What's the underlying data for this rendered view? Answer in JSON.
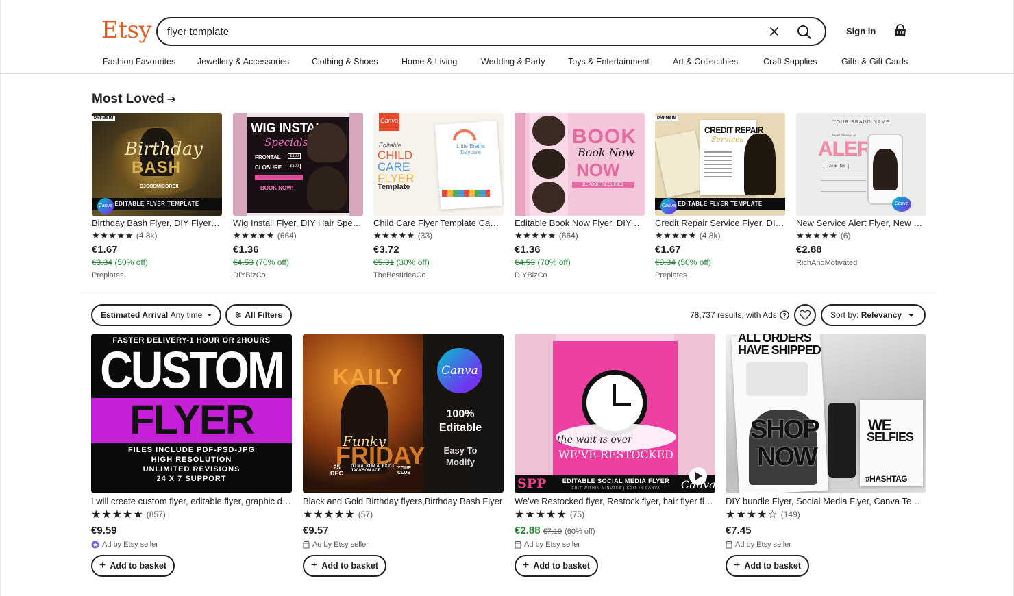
{
  "header": {
    "logo": "Etsy",
    "search_value": "flyer template",
    "signin": "Sign in"
  },
  "categories": [
    "Fashion Favourites",
    "Jewellery & Accessories",
    "Clothing & Shoes",
    "Home & Living",
    "Wedding & Party",
    "Toys & Entertainment",
    "Art & Collectibles",
    "Craft Supplies",
    "Gifts & Gift Cards"
  ],
  "most_loved": {
    "title": "Most Loved",
    "items": [
      {
        "title": "Birthday Bash Flyer, DIY Flyer Template, Birthday Party Flyer",
        "stars": "★★★★★",
        "reviews": "(4.8k)",
        "price": "€1.67",
        "original": "€3.34",
        "discount": "(50% off)",
        "shop": "Preplates",
        "art": {
          "badge": "PREMIUM",
          "line1": "Birthday",
          "line2": "BASH",
          "strip": "EDITABLE FLYER TEMPLATE",
          "canva": "Canva",
          "dj": "DJCOSMICOREX"
        }
      },
      {
        "title": "Wig Install Flyer, DIY Hair Specials Flyer",
        "stars": "★★★★★",
        "reviews": "(664)",
        "price": "€1.36",
        "original": "€4.53",
        "discount": "(70% off)",
        "shop": "DIYBizCo",
        "art": {
          "line1": "WIG INSTALL",
          "line2": "Specials",
          "row1": "FRONTAL",
          "row2": "CLOSURE",
          "p1": "$100",
          "p2": "$100",
          "cta": "BOOK NOW!"
        }
      },
      {
        "title": "Child Care Flyer Template Canva Editable",
        "stars": "★★★★★",
        "reviews": "(33)",
        "price": "€3.72",
        "original": "€5.31",
        "discount": "(30% off)",
        "shop": "TheBestIdeaCo",
        "art": {
          "canva": "Canva",
          "small": "Editable",
          "w1": "CHILD",
          "w2": "CARE",
          "w3": "FLYER",
          "w4": "Template",
          "sub": "Little Brains Daycare"
        }
      },
      {
        "title": "Editable Book Now Flyer, DIY Beauty Flyer",
        "stars": "★★★★★",
        "reviews": "(664)",
        "price": "€1.36",
        "original": "€4.53",
        "discount": "(70% off)",
        "shop": "DIYBizCo",
        "art": {
          "w1": "BOOK",
          "w2": "Book Now",
          "w3": "NOW",
          "dep": "DEPOSIT REQUIRED"
        }
      },
      {
        "title": "Credit Repair Service Flyer, DIY Business Flyer",
        "stars": "★★★★★",
        "reviews": "(4.8k)",
        "price": "€1.67",
        "original": "€3.34",
        "discount": "(50% off)",
        "shop": "Preplates",
        "art": {
          "badge": "PREMIUM",
          "w1": "CREDIT REPAIR",
          "w2": "Services",
          "strip": "EDITABLE FLYER TEMPLATE",
          "canva": "Canva"
        }
      },
      {
        "title": "New Service Alert Flyer, New Service Template",
        "stars": "★★★★★",
        "reviews": "(6)",
        "price": "€2.88",
        "original": "",
        "discount": "",
        "shop": "RichAndMotivated",
        "art": {
          "top": "YOUR BRAND NAME",
          "w1": "ALERT",
          "w0": "NEW SERVICE",
          "tag": "TAPE INS",
          "canva": "Canva"
        }
      }
    ]
  },
  "filters": {
    "arrival_label": "Estimated Arrival",
    "arrival_value": "Any time",
    "all_filters": "All Filters",
    "results": "78,737 results, with Ads",
    "sort_label": "Sort by:",
    "sort_value": "Relevancy"
  },
  "listings": [
    {
      "title": "I will create custom flyer, editable flyer, graphic design",
      "stars": "★★★★★",
      "reviews": "(857)",
      "price": "€9.59",
      "was": "",
      "ad": "Ad by Etsy seller",
      "button": "Add to basket",
      "art": {
        "top": "FASTER DELIVERY-1 HOUR OR 2HOURS",
        "w1": "CUSTOM",
        "w2": "FLYER",
        "b1": "FILES INCLUDE PDF-PSD-JPG",
        "b2": "HIGH RESOLUTION",
        "b3": "UNLIMITED REVISIONS",
        "b4": "24 X 7 SUPPORT"
      }
    },
    {
      "title": "Black and Gold Birthday flyers,Birthday Bash Flyer",
      "stars": "★★★★★",
      "reviews": "(57)",
      "price": "€9.57",
      "was": "",
      "ad": "Ad by Etsy seller",
      "button": "Add to basket",
      "art": {
        "w1": "KAILY",
        "w2": "Funky",
        "w3": "FRIDAY",
        "canva": "Canva",
        "e1": "100%",
        "e2": "Editable",
        "e3": "Easy To",
        "e4": "Modify",
        "date1": "25",
        "date2": "DEC",
        "dj": "DJ MALKUM ALEX  DJ JACKSON ACE",
        "club": "YOUR CLUB"
      }
    },
    {
      "title": "We've Restocked flyer, Restock flyer, hair flyer flyer",
      "stars": "★★★★★",
      "reviews": "(75)",
      "price": "€2.88",
      "was": "€7.19",
      "discount": "(60% off)",
      "ad": "Ad by Etsy seller",
      "button": "Add to basket",
      "art": {
        "w1": "the wait is over",
        "w2": "WE'VE RESTOCKED",
        "strip": "EDITABLE SOCIAL MEDIA FLYER",
        "sub": "EDIT WITHIN MINUTES  |  EDIT IN CANVA",
        "spp": "SPP",
        "canva": "Canva"
      }
    },
    {
      "title": "DIY bundle Flyer, Social Media Flyer, Canva Template",
      "stars": "★★★★☆",
      "reviews": "(149)",
      "price": "€7.45",
      "was": "",
      "ad": "Ad by Etsy seller",
      "button": "Add to basket",
      "art": {
        "w0": "ALL ORDERS HAVE SHIPPED",
        "w1": "SHOP",
        "w2": "NOW",
        "w3": "WE",
        "w4": "SELFIES",
        "w5": "#HASHTAG"
      }
    }
  ],
  "colors": {
    "brand": "#e4621f",
    "sale": "#258635",
    "text": "#222222"
  }
}
